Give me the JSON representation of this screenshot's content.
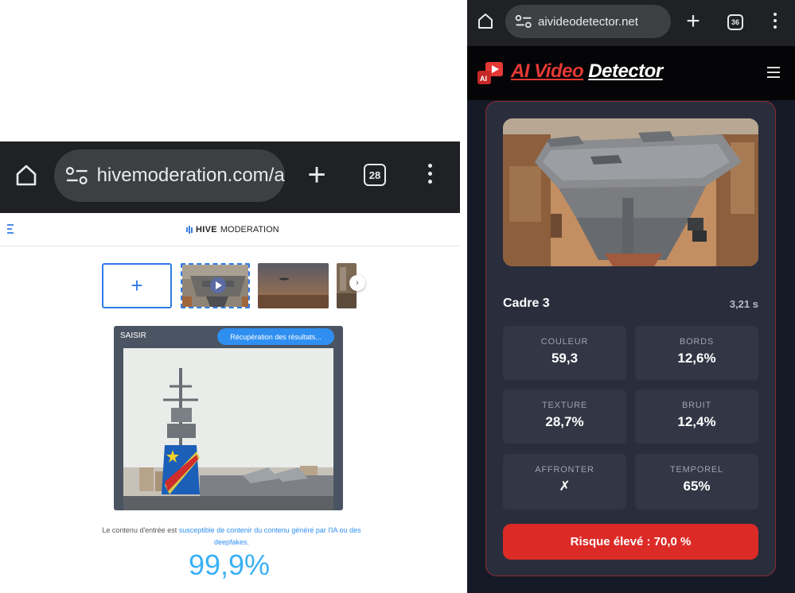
{
  "left": {
    "browser": {
      "url": "hivemoderation.com/ai-ge",
      "tab_count": "28"
    },
    "brand": {
      "name": "HIVE",
      "suffix": "MODERATION"
    },
    "card": {
      "label": "SAISIR",
      "status": "Récupération des résultats..."
    },
    "result": {
      "text_before": "Le contenu d'entrée est ",
      "text_highlight": "susceptible de contenir du contenu généré par l'IA ou des deepfakes.",
      "score": "99,9%"
    }
  },
  "right": {
    "browser": {
      "url": "aivideodetector.net",
      "tab_count": "36"
    },
    "brand": {
      "part1": "AI Video",
      "part2": "Detector",
      "logo_badge": "AI"
    },
    "frame": {
      "title": "Cadre 3",
      "time": "3,21 s"
    },
    "stats": [
      {
        "label": "COULEUR",
        "value": "59,3"
      },
      {
        "label": "BORDS",
        "value": "12,6%"
      },
      {
        "label": "TEXTURE",
        "value": "28,7%"
      },
      {
        "label": "BRUIT",
        "value": "12,4%"
      },
      {
        "label": "AFFRONTER",
        "value": "✗"
      },
      {
        "label": "TEMPOREL",
        "value": "65%"
      }
    ],
    "risk": "Risque élevé : 70,0 %"
  },
  "colors": {
    "hive_blue": "#2f8ff0",
    "score_blue": "#3ab0f5",
    "risk_red": "#dc2b27",
    "brand_red": "#e53935"
  }
}
